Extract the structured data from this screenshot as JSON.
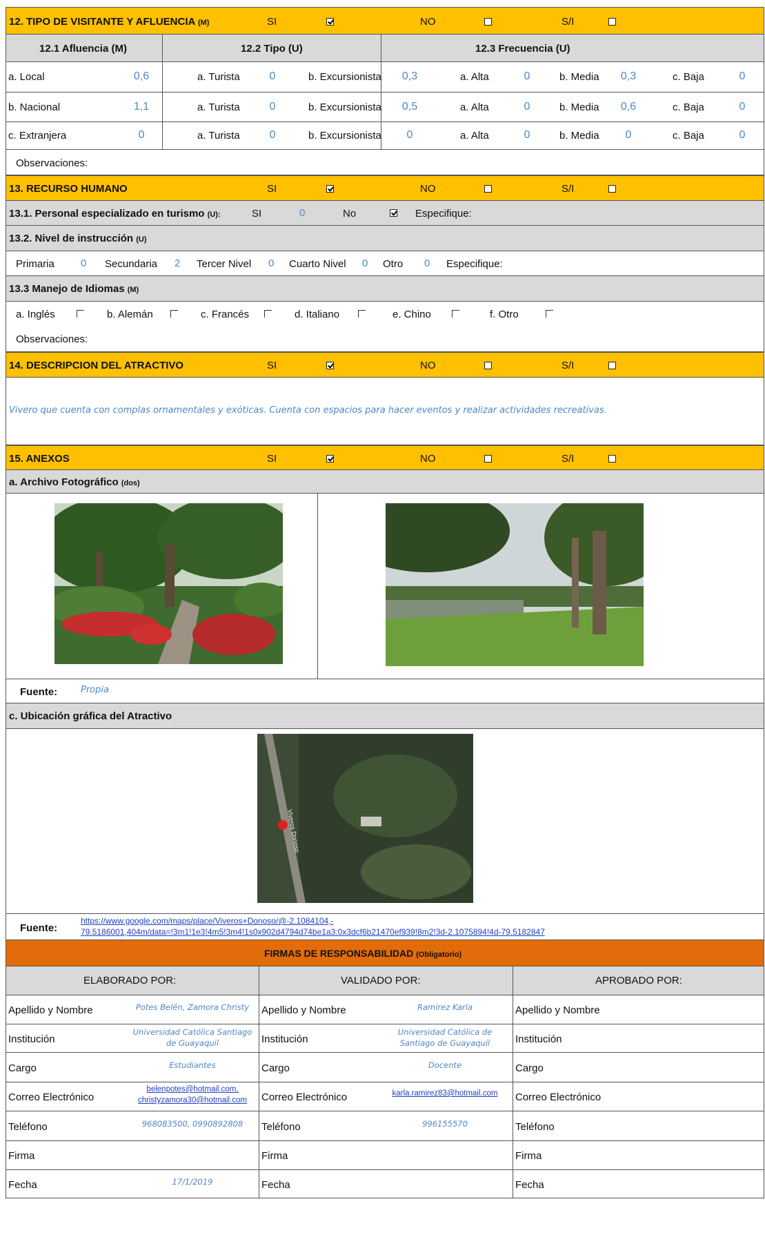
{
  "s12": {
    "title": "12. TIPO DE VISITANTE Y AFLUENCIA",
    "title_m": "(M)",
    "si": "SI",
    "no": "NO",
    "si_label": "S/I",
    "h1": "12.1 Afluencia (M)",
    "h2": "12.2 Tipo (U)",
    "h3": "12.3 Frecuencia (U)",
    "rows": [
      {
        "label": "a. Local",
        "af": "0,6",
        "t_lbl": "a. Turista",
        "t": "0",
        "e_lbl": "b. Excursionista",
        "e": "0,3",
        "a_lbl": "a. Alta",
        "a": "0",
        "m_lbl": "b. Media",
        "m": "0,3",
        "bj_lbl": "c. Baja",
        "bj": "0"
      },
      {
        "label": "b. Nacional",
        "af": "1,1",
        "t_lbl": "a. Turista",
        "t": "0",
        "e_lbl": "b. Excursionista",
        "e": "0,5",
        "a_lbl": "a. Alta",
        "a": "0",
        "m_lbl": "b. Media",
        "m": "0,6",
        "bj_lbl": "c. Baja",
        "bj": "0"
      },
      {
        "label": "c. Extranjera",
        "af": "0",
        "t_lbl": "a. Turista",
        "t": "0",
        "e_lbl": "b. Excursionista",
        "e": "0",
        "a_lbl": "a. Alta",
        "a": "0",
        "m_lbl": "b. Media",
        "m": "0",
        "bj_lbl": "c. Baja",
        "bj": "0"
      }
    ],
    "obs": "Observaciones:"
  },
  "s13": {
    "title": "13. RECURSO HUMANO",
    "si": "SI",
    "no": "NO",
    "si_label": "S/I",
    "p131": "13.1. Personal especializado en turismo",
    "p131_u": "(U):",
    "p131_si": "SI",
    "p131_si_val": "0",
    "p131_no": "No",
    "p131_esp": "Especifique:",
    "p132": "13.2. Nivel de instrucción",
    "p132_u": "(U)",
    "lvl": [
      {
        "l": "Primaria",
        "v": "0"
      },
      {
        "l": "Secundaria",
        "v": "2"
      },
      {
        "l": "Tercer Nivel",
        "v": "0"
      },
      {
        "l": "Cuarto Nivel",
        "v": "0"
      },
      {
        "l": "Otro",
        "v": "0"
      }
    ],
    "lvl_esp": "Especifique:",
    "p133": "13.3 Manejo de Idiomas",
    "p133_m": "(M)",
    "langs": [
      "a. Inglés",
      "b. Alemán",
      "c. Francés",
      "d. Italiano",
      "e. Chino",
      "f. Otro"
    ],
    "obs": "Observaciones:"
  },
  "s14": {
    "title": "14. DESCRIPCION DEL ATRACTIVO",
    "si": "SI",
    "no": "NO",
    "si_label": "S/I",
    "desc": "Vivero que cuenta con complas ornamentales y exóticas. Cuenta con espacios para hacer eventos y realizar actividades recreativas."
  },
  "s15": {
    "title": "15. ANEXOS",
    "si": "SI",
    "no": "NO",
    "si_label": "S/I",
    "foto": "a. Archivo Fotográfico",
    "foto_s": "(dos)",
    "fuente": "Fuente:",
    "fuente_val": "Propia",
    "ubic": "c. Ubicación gráfica del Atractivo",
    "map_road": "Viveros Donoso",
    "fuente2": "Fuente:",
    "url1": "https://www.google.com/maps/place/Viveros+Donoso/@-2.1084104,-",
    "url2": "79.5186001,404m/data=!3m1!1e3!4m5!3m4!1s0x902d4794d74be1a3:0x3dcf6b21470ef939!8m2!3d-2.1075894!4d-79.5182847"
  },
  "firmas": {
    "title": "FIRMAS DE RESPONSABILIDAD",
    "title_s": "(Obligatorio)",
    "cols": [
      "ELABORADO POR:",
      "VALIDADO  POR:",
      "APROBADO POR:"
    ],
    "labels": [
      "Apellido y Nombre",
      "Institución",
      "Cargo",
      "Correo Electrónico",
      "Teléfono",
      "Firma",
      "Fecha"
    ],
    "c1": {
      "nombre": "Potes Belén, Zamora Christy",
      "inst1": "Universidad Católica Santiago",
      "inst2": "de Guayaquil",
      "cargo": "Estudiantes",
      "mail1": "belenpotes@hotmail.com,",
      "mail2": "christyzamora30@hotmail.com",
      "tel": "968083500, 0990892808",
      "fecha": "17/1/2019"
    },
    "c2": {
      "nombre": "Ramirez Karla",
      "inst1": "Universidad Católica de",
      "inst2": "Santiago de Guayaquil",
      "cargo": "Docente",
      "mail": "karla.ramirez83@hotmail.com",
      "tel": "996155570"
    }
  },
  "colors": {
    "yellow": "#ffc000",
    "gray": "#d9d9d9",
    "orange": "#e26b0a",
    "value_blue": "#4f86c6"
  }
}
